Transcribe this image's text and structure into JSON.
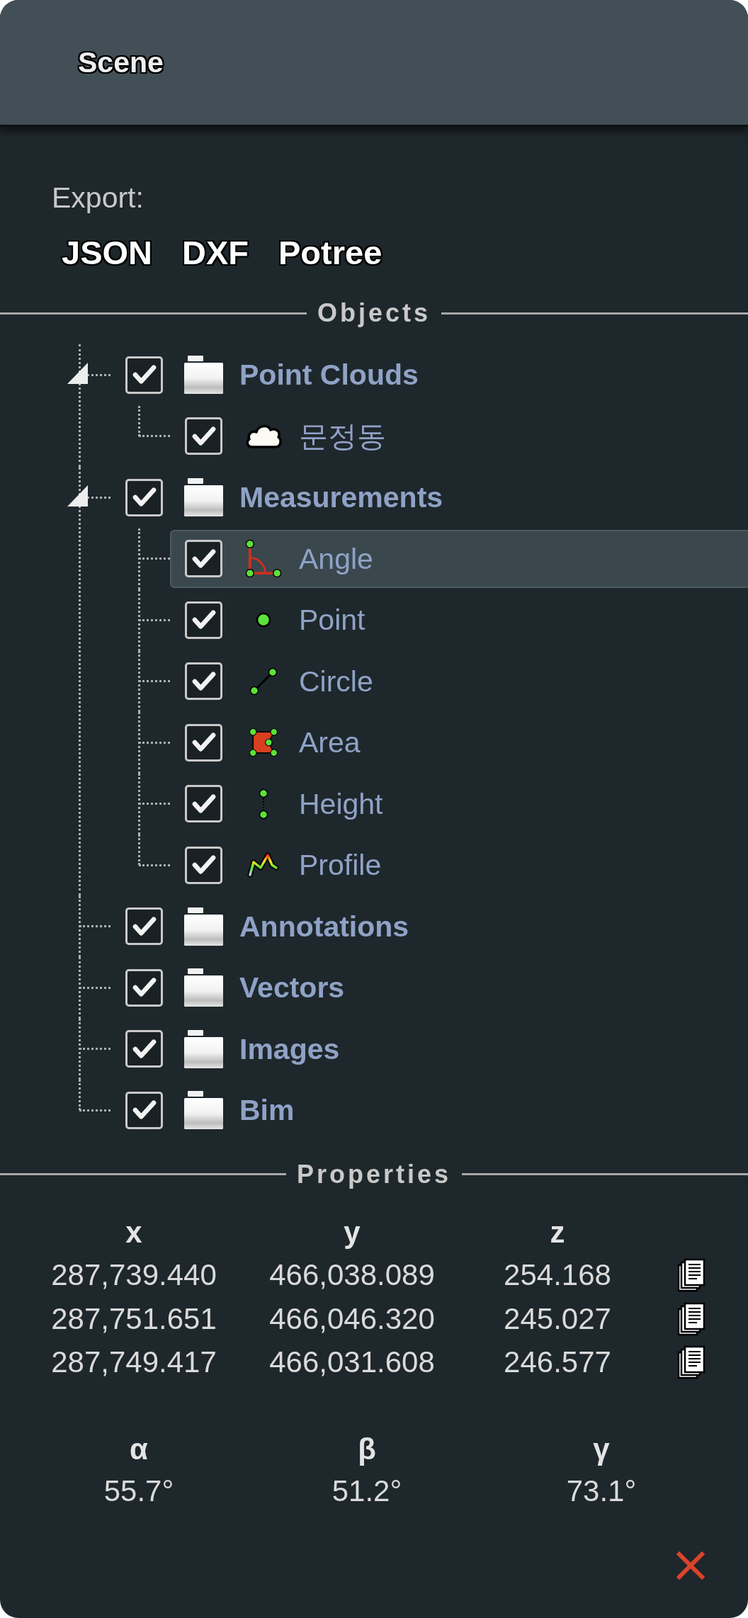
{
  "header": {
    "title": "Scene"
  },
  "export": {
    "label": "Export:",
    "formats": [
      "JSON",
      "DXF",
      "Potree"
    ]
  },
  "objects": {
    "title": "Objects",
    "tree": [
      {
        "label": "Point Clouds",
        "kind": "folder",
        "checked": true,
        "selected": false,
        "expanded": true,
        "children": [
          {
            "label": "문정동",
            "kind": "point_cloud",
            "checked": true,
            "selected": false
          }
        ]
      },
      {
        "label": "Measurements",
        "kind": "folder",
        "checked": true,
        "selected": false,
        "expanded": true,
        "children": [
          {
            "label": "Angle",
            "kind": "angle",
            "checked": true,
            "selected": true
          },
          {
            "label": "Point",
            "kind": "point",
            "checked": true,
            "selected": false
          },
          {
            "label": "Circle",
            "kind": "circle",
            "checked": true,
            "selected": false
          },
          {
            "label": "Area",
            "kind": "area",
            "checked": true,
            "selected": false
          },
          {
            "label": "Height",
            "kind": "height",
            "checked": true,
            "selected": false
          },
          {
            "label": "Profile",
            "kind": "profile",
            "checked": true,
            "selected": false
          }
        ]
      },
      {
        "label": "Annotations",
        "kind": "folder",
        "checked": true,
        "selected": false
      },
      {
        "label": "Vectors",
        "kind": "folder",
        "checked": true,
        "selected": false
      },
      {
        "label": "Images",
        "kind": "folder",
        "checked": true,
        "selected": false
      },
      {
        "label": "Bim",
        "kind": "folder",
        "checked": true,
        "selected": false
      }
    ]
  },
  "properties": {
    "title": "Properties",
    "coordinates": {
      "columns": [
        "x",
        "y",
        "z"
      ],
      "rows": [
        [
          "287,739.440",
          "466,038.089",
          "254.168"
        ],
        [
          "287,751.651",
          "466,046.320",
          "245.027"
        ],
        [
          "287,749.417",
          "466,031.608",
          "246.577"
        ]
      ]
    },
    "angles": {
      "columns": [
        "α",
        "β",
        "γ"
      ],
      "values": [
        "55.7°",
        "51.2°",
        "73.1°"
      ]
    }
  }
}
